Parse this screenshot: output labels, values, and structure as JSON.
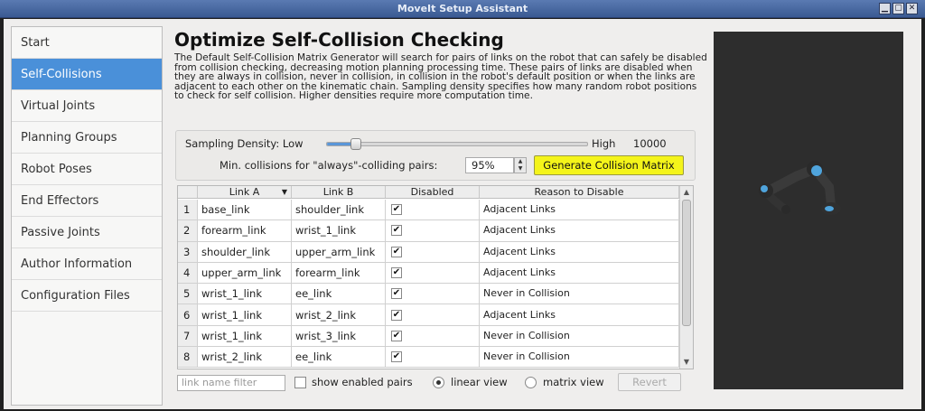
{
  "window": {
    "title": "MoveIt Setup Assistant",
    "buttons": [
      "▁",
      "▢",
      "✕"
    ]
  },
  "sidebar": {
    "items": [
      {
        "label": "Start"
      },
      {
        "label": "Self-Collisions",
        "active": true
      },
      {
        "label": "Virtual Joints"
      },
      {
        "label": "Planning Groups"
      },
      {
        "label": "Robot Poses"
      },
      {
        "label": "End Effectors"
      },
      {
        "label": "Passive Joints"
      },
      {
        "label": "Author Information"
      },
      {
        "label": "Configuration Files"
      }
    ]
  },
  "main": {
    "title": "Optimize Self-Collision Checking",
    "description": "The Default Self-Collision Matrix Generator will search for pairs of links on the robot that can safely be disabled from collision checking, decreasing motion planning processing time. These pairs of links are disabled when they are always in collision, never in collision, in collision in the robot's default position or when the links are adjacent to each other on the kinematic chain. Sampling density specifies how many random robot positions to check for self collision. Higher densities require more computation time."
  },
  "sampling": {
    "label": "Sampling Density: Low",
    "high_label": "High",
    "value": "10000",
    "slider_fraction": 0.11,
    "min_collisions_label": "Min. collisions for \"always\"-colliding pairs:",
    "min_collisions_value": "95%",
    "generate_button": "Generate Collision Matrix",
    "generate_button_color": "#f4f41a"
  },
  "table": {
    "headers": [
      "Link A",
      "Link B",
      "Disabled",
      "Reason to Disable"
    ],
    "rows": [
      {
        "num": "1",
        "a": "base_link",
        "b": "shoulder_link",
        "disabled": "✔",
        "reason": "Adjacent Links"
      },
      {
        "num": "2",
        "a": "forearm_link",
        "b": "wrist_1_link",
        "disabled": "✔",
        "reason": "Adjacent Links"
      },
      {
        "num": "3",
        "a": "shoulder_link",
        "b": "upper_arm_link",
        "disabled": "✔",
        "reason": "Adjacent Links"
      },
      {
        "num": "4",
        "a": "upper_arm_link",
        "b": "forearm_link",
        "disabled": "✔",
        "reason": "Adjacent Links"
      },
      {
        "num": "5",
        "a": "wrist_1_link",
        "b": "ee_link",
        "disabled": "✔",
        "reason": "Never in Collision"
      },
      {
        "num": "6",
        "a": "wrist_1_link",
        "b": "wrist_2_link",
        "disabled": "✔",
        "reason": "Adjacent Links"
      },
      {
        "num": "7",
        "a": "wrist_1_link",
        "b": "wrist_3_link",
        "disabled": "✔",
        "reason": "Never in Collision"
      },
      {
        "num": "8",
        "a": "wrist_2_link",
        "b": "ee_link",
        "disabled": "✔",
        "reason": "Never in Collision"
      }
    ]
  },
  "footer": {
    "filter_placeholder": "link name filter",
    "show_enabled_label": "show enabled pairs",
    "linear_view_label": "linear view",
    "matrix_view_label": "matrix view",
    "selected_view": "linear view",
    "revert_button": "Revert"
  },
  "colors": {
    "accent": "#4a90d9",
    "viewport_bg": "#2d2d2d"
  }
}
